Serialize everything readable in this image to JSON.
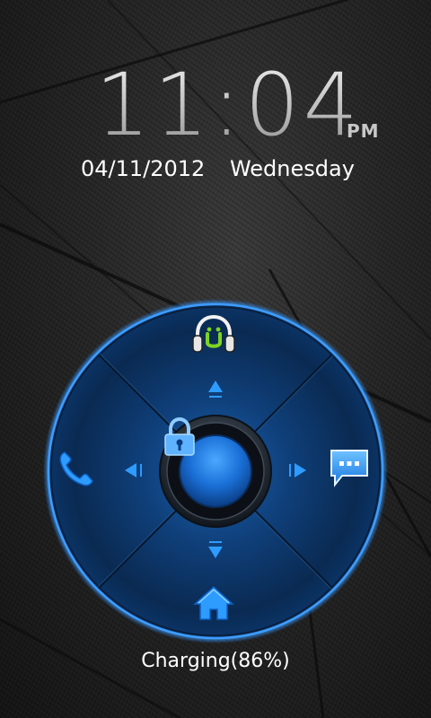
{
  "lockscreen": {
    "time": "11:04",
    "ampm": "PM",
    "date": "04/11/2012",
    "day": "Wednesday"
  },
  "status": {
    "charging_text": "Charging(86%)",
    "battery_percent": 86
  },
  "dial": {
    "center_icon": "lock-icon",
    "top_target": "headphones-music-icon",
    "left_target": "phone-icon",
    "right_target": "message-icon",
    "bottom_target": "home-icon",
    "accent_color": "#1e90ff",
    "glow_color": "#0a4c9a",
    "music_badge_color": "#7dd321"
  }
}
